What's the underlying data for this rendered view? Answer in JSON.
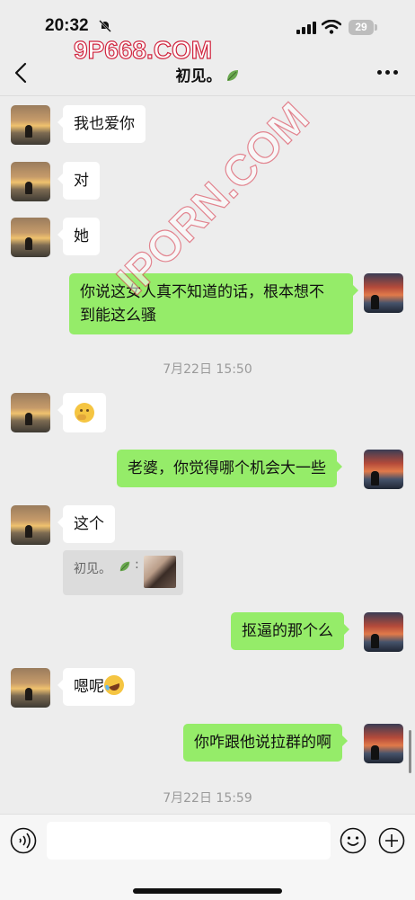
{
  "status_bar": {
    "time": "20:32",
    "battery": "29"
  },
  "watermark": {
    "top": "9P668.COM",
    "diagonal": "IPORN.COM"
  },
  "nav": {
    "title": "初见。"
  },
  "messages": [
    {
      "side": "left",
      "text": "我也爱你"
    },
    {
      "side": "left",
      "text": "对"
    },
    {
      "side": "left",
      "text": "她"
    },
    {
      "side": "right",
      "line1": "你说这女人真不知道的话，根本想不",
      "line2": "到能这么骚"
    },
    {
      "side": "left",
      "emoji": "thinking-face"
    },
    {
      "side": "right",
      "text": "老婆，你觉得哪个机会大一些"
    },
    {
      "side": "left",
      "text": "这个"
    },
    {
      "side": "right",
      "text": "抠逼的那个么"
    },
    {
      "side": "left",
      "text": "嗯呢",
      "emoji": "laughing-tears-face"
    },
    {
      "side": "right",
      "text": "你咋跟他说拉群的啊"
    }
  ],
  "timestamps": [
    "7月22日 15:50",
    "7月22日 15:59"
  ],
  "quote": {
    "name": "初见。",
    "colon": ":"
  },
  "input": {
    "value": "",
    "placeholder": ""
  },
  "colors": {
    "bubble_right": "#95ec69",
    "bubble_left": "#ffffff",
    "background": "#ededed"
  }
}
